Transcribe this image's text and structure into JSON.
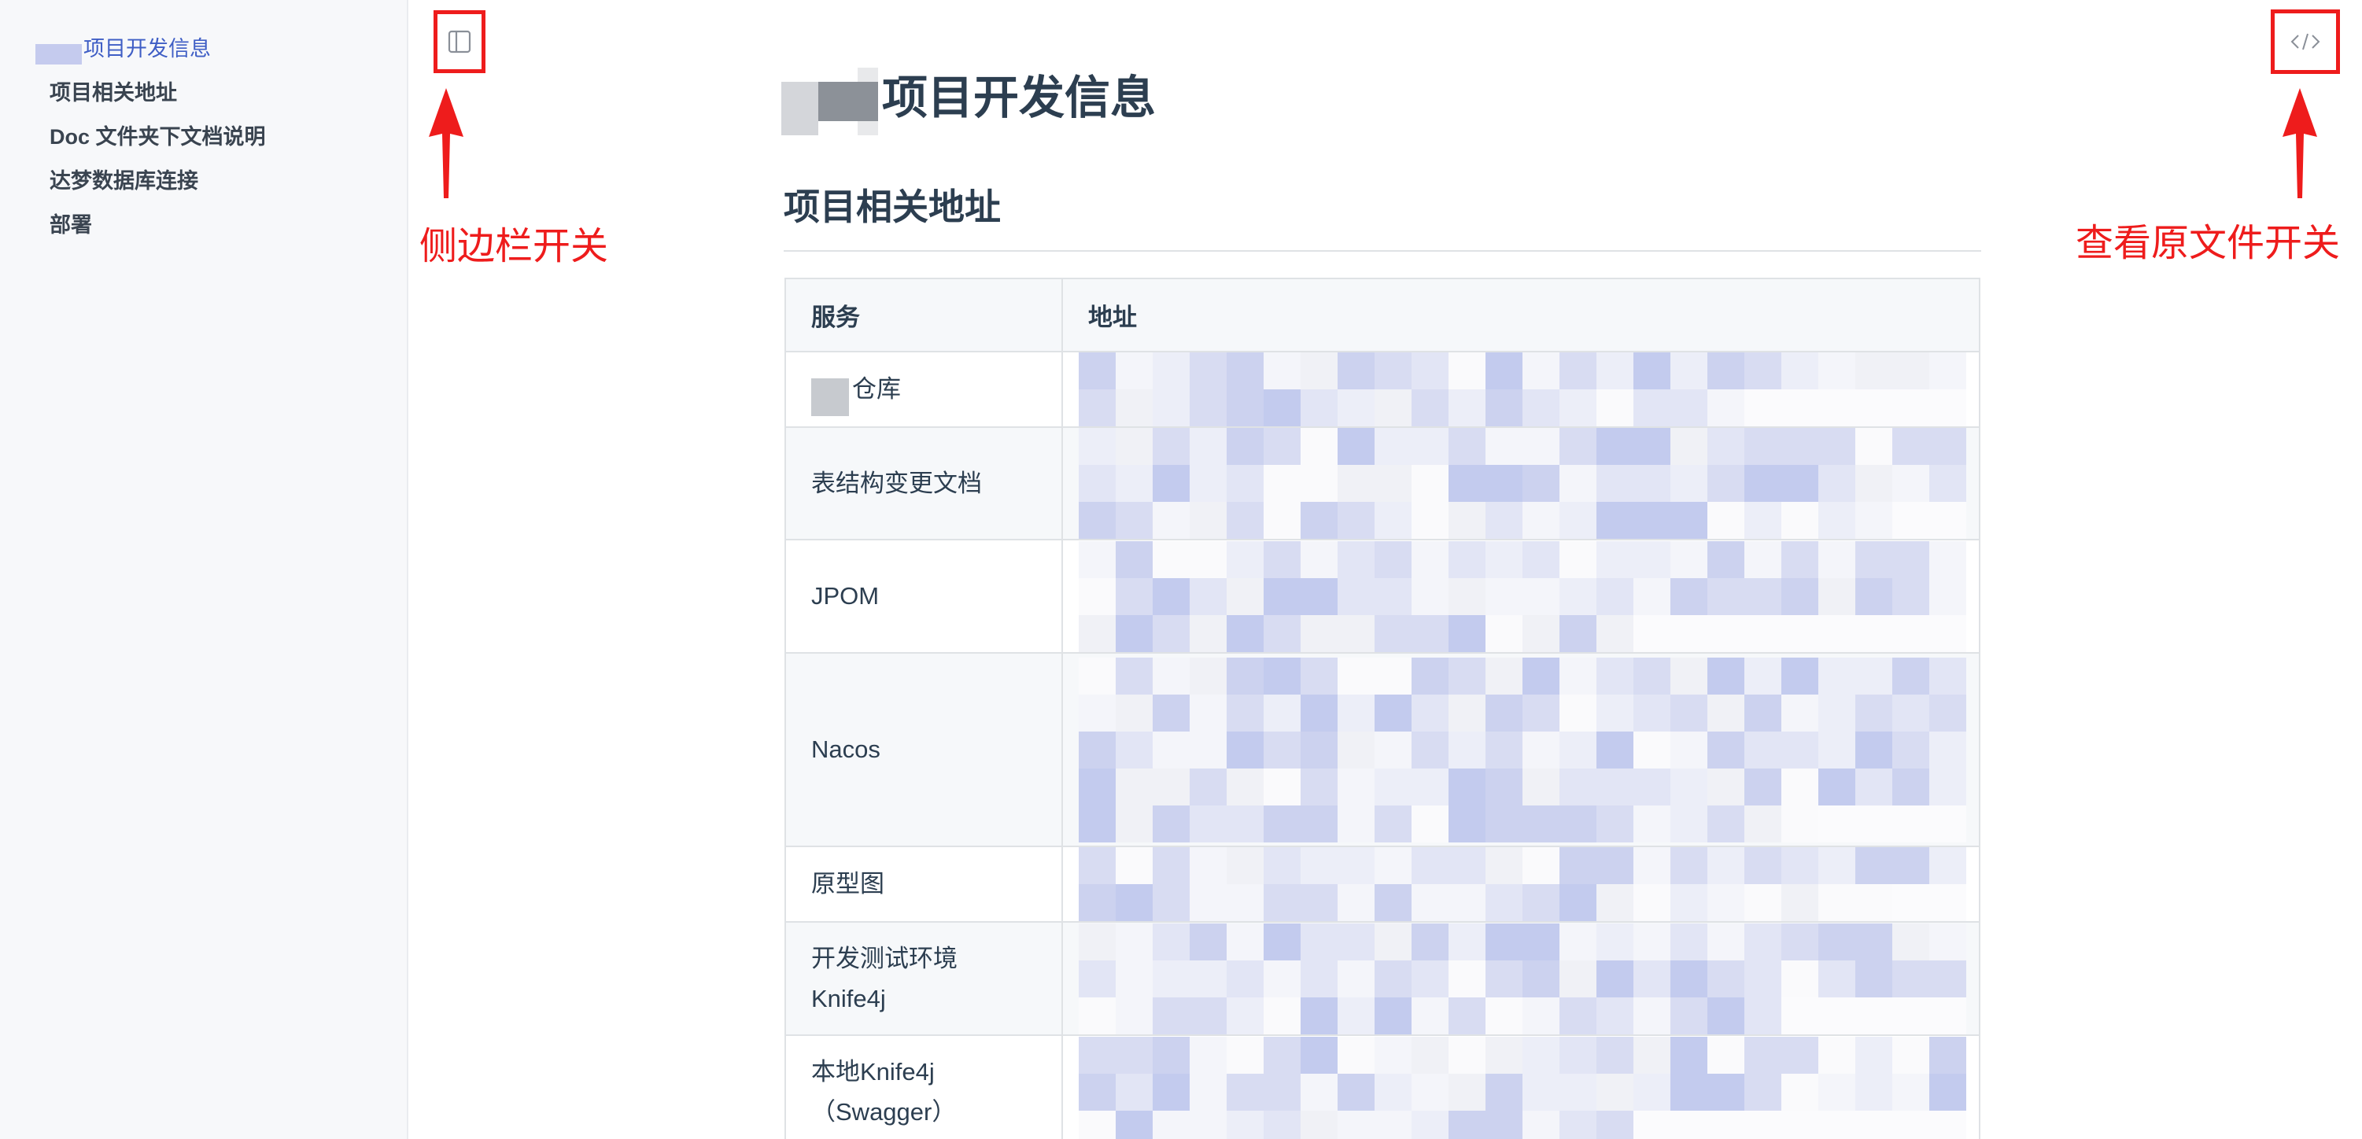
{
  "sidebar": {
    "items": [
      {
        "label": "项目开发信息",
        "active": true
      },
      {
        "label": "项目相关地址"
      },
      {
        "label": "Doc 文件夹下文档说明"
      },
      {
        "label": "达梦数据库连接"
      },
      {
        "label": "部署"
      }
    ]
  },
  "annotations": {
    "sidebar_toggle": "侧边栏开关",
    "source_toggle": "查看原文件开关"
  },
  "icons": {
    "sidebar_toggle": "sidebar-panel-icon",
    "source_toggle": "code-brackets-icon"
  },
  "main": {
    "page_title": "项目开发信息",
    "section_title": "项目相关地址",
    "table": {
      "headers": [
        "服务",
        "地址"
      ],
      "rows": [
        {
          "service": "仓库"
        },
        {
          "service": "表结构变更文档"
        },
        {
          "service": "JPOM"
        },
        {
          "service": "Nacos"
        },
        {
          "service": "原型图"
        },
        {
          "service_line1": "开发测试环境",
          "service_line2": "Knife4j"
        },
        {
          "service_line1": "本地Knife4j",
          "service_line2": "（Swagger）"
        }
      ]
    }
  },
  "colors": {
    "accent": "#3f5ec5",
    "annotation_red": "#ee1c1c",
    "text": "#2c3e50",
    "table_border": "#dfe2e5"
  }
}
